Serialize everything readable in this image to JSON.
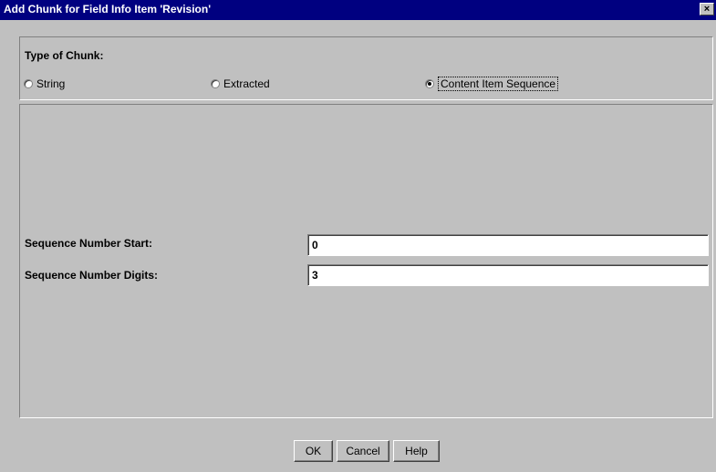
{
  "window": {
    "title": "Add Chunk for Field Info Item 'Revision'",
    "close_symbol": "×",
    "title_bar_color": "#000080",
    "face_color": "#c0c0c0"
  },
  "chunk_type": {
    "label": "Type of Chunk:",
    "options": [
      {
        "label": "String",
        "checked": false
      },
      {
        "label": "Extracted",
        "checked": false
      },
      {
        "label": "Content Item Sequence",
        "checked": true
      }
    ]
  },
  "sequence": {
    "start_label": "Sequence Number Start:",
    "start_value": "0",
    "digits_label": "Sequence Number Digits:",
    "digits_value": "3"
  },
  "buttons": {
    "ok": "OK",
    "cancel": "Cancel",
    "help": "Help"
  }
}
